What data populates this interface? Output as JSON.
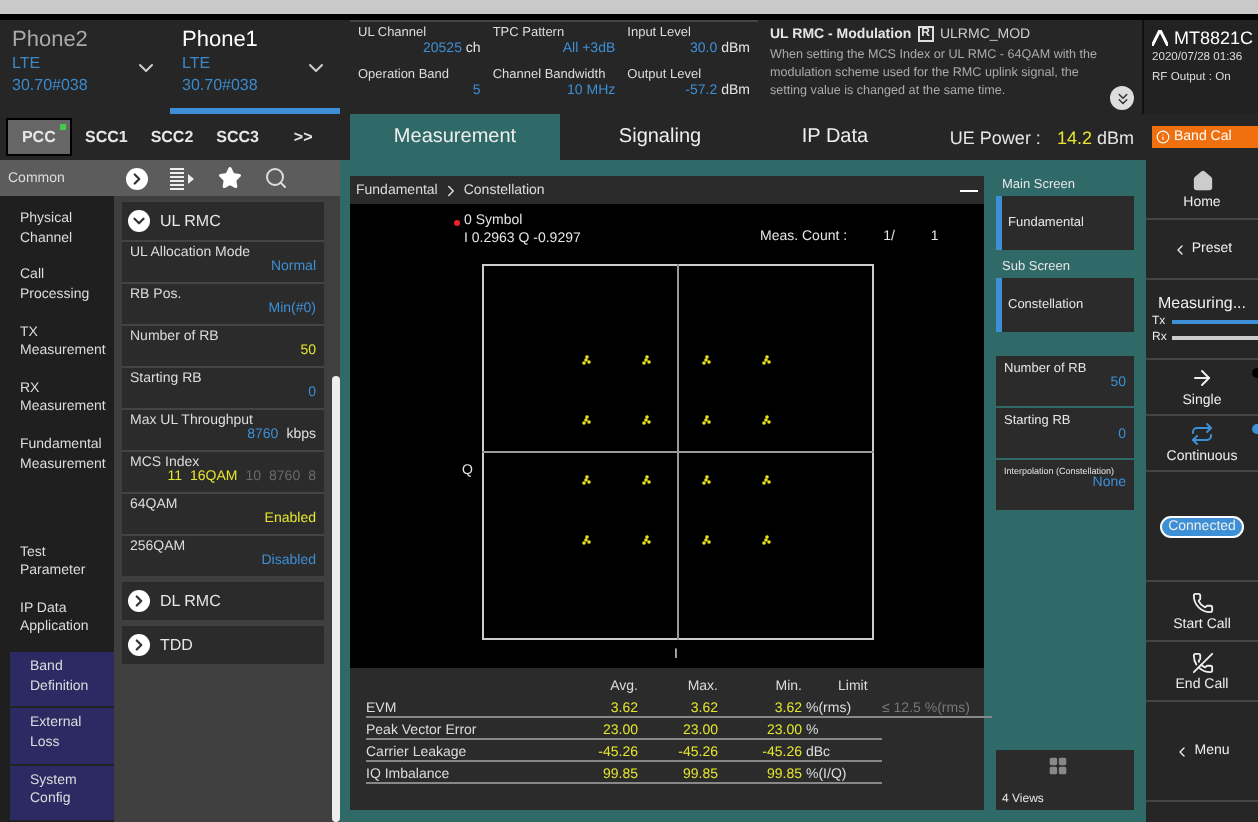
{
  "header": {
    "phones": [
      {
        "name": "Phone2",
        "tech": "LTE",
        "version": "30.70#038",
        "selected": false
      },
      {
        "name": "Phone1",
        "tech": "LTE",
        "version": "30.70#038",
        "selected": true
      }
    ],
    "params": [
      {
        "label": "UL Channel",
        "value": "20525",
        "unit": "ch"
      },
      {
        "label": "TPC Pattern",
        "value": "All +3dB"
      },
      {
        "label": "Input Level",
        "value": "30.0",
        "unit": "dBm"
      },
      {
        "label": "Operation Band",
        "value": "5"
      },
      {
        "label": "Channel Bandwidth",
        "value": "10 MHz"
      },
      {
        "label": "Output Level",
        "value": "-57.2",
        "unit": "dBm"
      }
    ],
    "help": {
      "title": "UL RMC - Modulation",
      "badge": "R",
      "code": "ULRMC_MOD",
      "text": "When setting the MCS Index or UL RMC - 64QAM with the modulation scheme used for the RMC uplink signal, the setting value is changed at the same time."
    },
    "device": {
      "model": "MT8821C",
      "datetime": "2020/07/28 01:36",
      "rf_output": "RF Output : On"
    }
  },
  "carrier_tabs": [
    {
      "label": "PCC",
      "selected": true
    },
    {
      "label": "SCC1",
      "selected": false
    },
    {
      "label": "SCC2",
      "selected": false
    },
    {
      "label": "SCC3",
      "selected": false
    },
    {
      "label": ">>",
      "selected": false
    }
  ],
  "view_tabs": [
    {
      "label": "Measurement",
      "selected": true
    },
    {
      "label": "Signaling",
      "selected": false
    },
    {
      "label": "IP Data",
      "selected": false
    }
  ],
  "ue_power": {
    "label": "UE Power :",
    "value": "14.2",
    "unit": "dBm"
  },
  "alert": {
    "label": "Band Cal"
  },
  "toolbar": {
    "label": "Common"
  },
  "nav": [
    {
      "label": "Physical Channel",
      "kind": "main"
    },
    {
      "label": "Call Processing",
      "kind": "main"
    },
    {
      "label": "TX Measurement",
      "kind": "main"
    },
    {
      "label": "RX Measurement",
      "kind": "main"
    },
    {
      "label": "Fundamental Measurement",
      "kind": "main"
    },
    {
      "label": "Test Parameter",
      "kind": "main"
    },
    {
      "label": "IP Data Application",
      "kind": "main"
    },
    {
      "label": "Band Definition",
      "kind": "system"
    },
    {
      "label": "External Loss",
      "kind": "system"
    },
    {
      "label": "System Config",
      "kind": "system"
    }
  ],
  "settings": [
    {
      "title": "UL RMC",
      "expanded": true,
      "items": [
        {
          "label": "UL Allocation Mode",
          "values": [
            {
              "text": "Normal",
              "color": "#3d8fd6"
            }
          ]
        },
        {
          "label": "RB Pos.",
          "values": [
            {
              "text": "Min(#0)",
              "color": "#3d8fd6"
            }
          ]
        },
        {
          "label": "Number of RB",
          "values": [
            {
              "text": "50",
              "color": "#e6e62e"
            }
          ]
        },
        {
          "label": "Starting RB",
          "values": [
            {
              "text": "0",
              "color": "#3d8fd6"
            }
          ]
        },
        {
          "label": "Max UL Throughput",
          "values": [
            {
              "text": "8760",
              "color": "#3d8fd6"
            },
            {
              "text": "kbps",
              "color": "#e0e0e0"
            }
          ]
        },
        {
          "label": "MCS Index",
          "values": [
            {
              "text": "11",
              "color": "#e6e62e"
            },
            {
              "text": "16QAM",
              "color": "#e6e62e"
            },
            {
              "text": "10",
              "color": "#6a6a6a"
            },
            {
              "text": "8760",
              "color": "#6a6a6a"
            },
            {
              "text": "8",
              "color": "#6a6a6a"
            }
          ]
        },
        {
          "label": "64QAM",
          "values": [
            {
              "text": "Enabled",
              "color": "#e6e62e"
            }
          ]
        },
        {
          "label": "256QAM",
          "values": [
            {
              "text": "Disabled",
              "color": "#3d8fd6"
            }
          ]
        }
      ]
    },
    {
      "title": "DL RMC",
      "expanded": false
    },
    {
      "title": "TDD",
      "expanded": false
    }
  ],
  "graph": {
    "breadcrumb": [
      "Fundamental",
      "Constellation"
    ],
    "marker": {
      "label": "0 Symbol",
      "readout": "I 0.2963 Q -0.9297"
    },
    "meas_count": {
      "label": "Meas. Count :",
      "value": "1/",
      "total": "1"
    },
    "axis_q": "Q",
    "axis_i": "I"
  },
  "results": {
    "columns": [
      "Avg.",
      "Max.",
      "Min.",
      "Limit"
    ],
    "rows": [
      {
        "name": "EVM",
        "avg": "3.62",
        "max": "3.62",
        "min": "3.62",
        "unit": "%(rms)",
        "limit": "≤ 12.5 %(rms)"
      },
      {
        "name": "Peak Vector Error",
        "avg": "23.00",
        "max": "23.00",
        "min": "23.00",
        "unit": "%"
      },
      {
        "name": "Carrier Leakage",
        "avg": "-45.26",
        "max": "-45.26",
        "min": "-45.26",
        "unit": "dBc"
      },
      {
        "name": "IQ Imbalance",
        "avg": "99.85",
        "max": "99.85",
        "min": "99.85",
        "unit": "%(I/Q)"
      }
    ]
  },
  "screen_panel": {
    "main": {
      "label": "Main Screen",
      "value": "Fundamental"
    },
    "sub": {
      "label": "Sub Screen",
      "value": "Constellation"
    },
    "params": [
      {
        "label": "Number of RB",
        "value": "50",
        "small": false
      },
      {
        "label": "Starting RB",
        "value": "0",
        "small": false
      },
      {
        "label": "Interpolation (Constellation)",
        "value": "None",
        "small": true
      }
    ],
    "views": "4 Views"
  },
  "side": [
    {
      "kind": "home",
      "label": "Home"
    },
    {
      "kind": "preset",
      "label": "Preset"
    },
    {
      "kind": "status",
      "label": "Measuring...",
      "indicators": [
        {
          "label": "Tx",
          "active": true
        },
        {
          "label": "Rx",
          "active": false
        }
      ]
    },
    {
      "kind": "single",
      "label": "Single",
      "selected": false
    },
    {
      "kind": "continuous",
      "label": "Continuous",
      "selected": true
    },
    {
      "kind": "connected",
      "label": "Connected"
    },
    {
      "kind": "start_call",
      "label": "Start Call"
    },
    {
      "kind": "end_call",
      "label": "End Call"
    },
    {
      "kind": "menu",
      "label": "Menu"
    }
  ]
}
